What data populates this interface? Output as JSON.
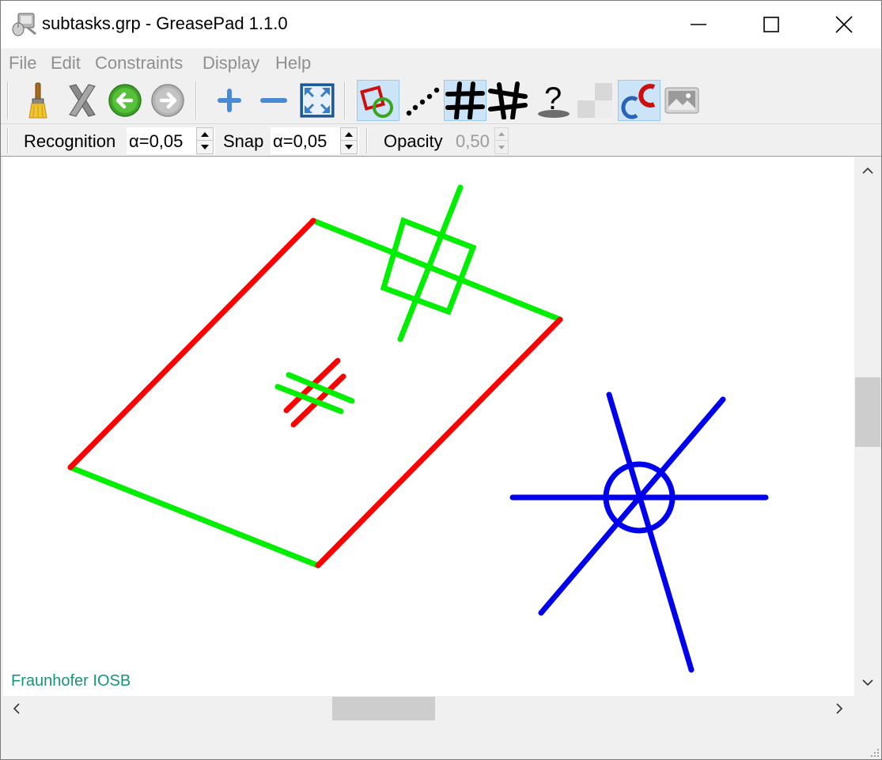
{
  "window": {
    "title": "subtasks.grp - GreasePad 1.1.0",
    "app_icon": "greasepad-app-icon",
    "controls": [
      "minimize-icon",
      "maximize-icon",
      "close-icon"
    ]
  },
  "menu": {
    "items": [
      {
        "label": "File"
      },
      {
        "label": "Edit"
      },
      {
        "label": "Constraints"
      },
      {
        "label": "Display"
      },
      {
        "label": "Help"
      }
    ]
  },
  "toolbar": {
    "buttons": [
      {
        "icon": "brush-icon",
        "active": false
      },
      {
        "icon": "delete-x-icon",
        "active": false
      },
      {
        "icon": "undo-arrow-icon",
        "active": false
      },
      {
        "icon": "redo-arrow-icon",
        "active": false
      },
      {
        "icon": "zoom-in-icon",
        "active": false
      },
      {
        "icon": "zoom-out-icon",
        "active": false
      },
      {
        "icon": "fit-to-window-icon",
        "active": false
      },
      {
        "icon": "toggle-constraints-icon",
        "active": true
      },
      {
        "icon": "toggle-points-icon",
        "active": false
      },
      {
        "icon": "toggle-consistent-icon",
        "active": true
      },
      {
        "icon": "toggle-inconsistent-icon",
        "active": false
      },
      {
        "icon": "toggle-unevaluated-icon",
        "active": false
      },
      {
        "icon": "toggle-background-icon",
        "active": false
      },
      {
        "icon": "toggle-colors-icon",
        "active": true
      },
      {
        "icon": "screenshot-icon",
        "active": false
      }
    ]
  },
  "options": {
    "recognition_label": "Recognition",
    "recognition_value": "α=0,05",
    "snap_label": "Snap",
    "snap_value": "α=0,05",
    "opacity_label": "Opacity",
    "opacity_value": "0,50"
  },
  "canvas": {
    "watermark": "Fraunhofer IOSB",
    "colors": {
      "green": "#00ee00",
      "red": "#ff0000",
      "blue": "#0000ee"
    }
  }
}
